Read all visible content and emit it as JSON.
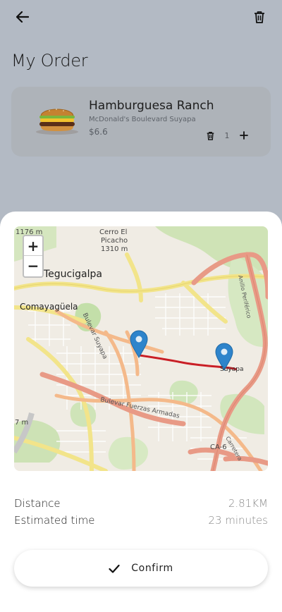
{
  "header": {
    "back_icon": "arrow-left-icon",
    "delete_icon": "trash-icon",
    "title": "My Order"
  },
  "order": {
    "item": {
      "name": "Hamburguesa Ranch",
      "store": "McDonald's Boulevard Suyapa",
      "price": "$6.6",
      "quantity": "1",
      "image": "burger-image"
    }
  },
  "map": {
    "zoom_in_label": "+",
    "zoom_out_label": "−",
    "labels": {
      "city": "Tegucigalpa",
      "city2": "Comayagüela",
      "peak": "Cerro El",
      "peak2": "Picacho",
      "peak3": "1310 m",
      "elev1": "1176 m",
      "elev2": "7 m",
      "road1": "Bulevar Suyapa",
      "road2": "Bulevar Fuerzas Armadas",
      "road3": "Anillo Periférico",
      "road4": "CA-6",
      "road5": "Carretera",
      "road6": "Suyapa"
    },
    "route_color": "#d3232a",
    "pin_color": "#2e84cb"
  },
  "summary": {
    "distance_label": "Distance",
    "distance_value": "2.81KM",
    "time_label": "Estimated time",
    "time_value": "23 minutes"
  },
  "confirm": {
    "label": "Confirm",
    "icon": "check-icon"
  }
}
